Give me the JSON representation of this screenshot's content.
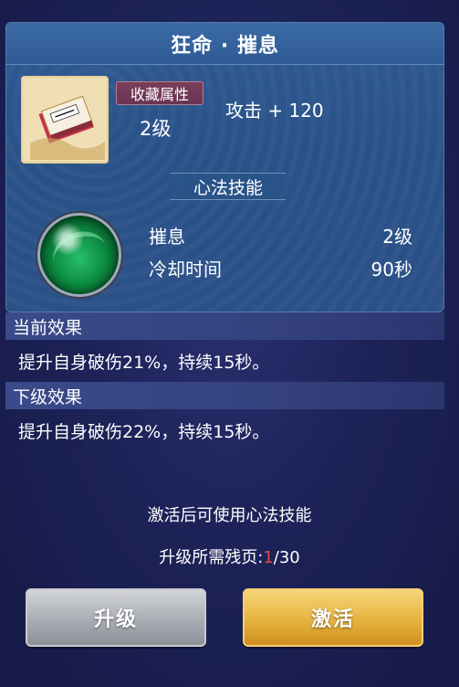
{
  "title": "狂命 · 摧息",
  "item": {
    "icon": "scroll-book-icon",
    "tag_label": "收藏属性",
    "level": "2级",
    "attribute": "攻击 + 120"
  },
  "skill": {
    "header": "心法技能",
    "icon": "green-orb-icon",
    "name": "摧息",
    "level": "2级",
    "cooldown_label": "冷却时间",
    "cooldown_value": "90秒"
  },
  "current_effect": {
    "label": "当前效果",
    "text": "提升自身破伤21%，持续15秒。"
  },
  "next_effect": {
    "label": "下级效果",
    "text": "提升自身破伤22%，持续15秒。"
  },
  "hint": "激活后可使用心法技能",
  "pages": {
    "label": "升级所需残页:",
    "current": "1",
    "total": "/30"
  },
  "buttons": {
    "upgrade": "升级",
    "activate": "激活"
  },
  "colors": {
    "accent_red": "#e14a4a",
    "activate_gold": "#e6b33e",
    "upgrade_gray": "#a9acb3"
  }
}
